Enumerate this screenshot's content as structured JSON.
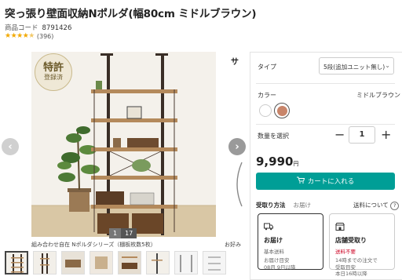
{
  "product": {
    "title": "突っ張り壁面収納Nポルダ(幅80cm ミドルブラウン)",
    "code_label": "商品コード",
    "code": "8791426",
    "rating_stars": 4.5,
    "review_count": "(396)"
  },
  "gallery": {
    "badge_line1": "特許",
    "badge_line2": "登録済",
    "prev_icon": "chevron-left",
    "next_icon": "chevron-right",
    "current": "1",
    "total": "17",
    "caption": "組み合わせ自在 Nポルダシリーズ（棚板枚数5枚）",
    "caption_right": "お好み",
    "side_char": "サ"
  },
  "options": {
    "type_label": "タイプ",
    "type_value": "5段(追加ユニット無し)",
    "color_label": "カラー",
    "color_value": "ミドルブラウン",
    "swatches": [
      {
        "name": "white",
        "color": "#ffffff"
      },
      {
        "name": "middle-brown",
        "color": "#c8856a"
      }
    ],
    "qty_label": "数量を選択",
    "qty_value": "1",
    "minus": "−",
    "plus": "+"
  },
  "price": {
    "amount": "9,990",
    "unit": "円"
  },
  "cart": {
    "label": "カートに入れる",
    "color": "#009e96"
  },
  "delivery": {
    "tab_active": "受取り方法",
    "tab_inactive": "お届け",
    "shipping_info": "送料について",
    "cards": [
      {
        "title": "お届け",
        "line1": "基本送料",
        "line2a": "お届け目安",
        "line2b": "08月 9日以降"
      },
      {
        "title": "店舗受取り",
        "line1": "送料不要",
        "line2a": "14時までの注文で",
        "line2b": "受取目安",
        "line2c": "本日16時以降"
      }
    ]
  }
}
